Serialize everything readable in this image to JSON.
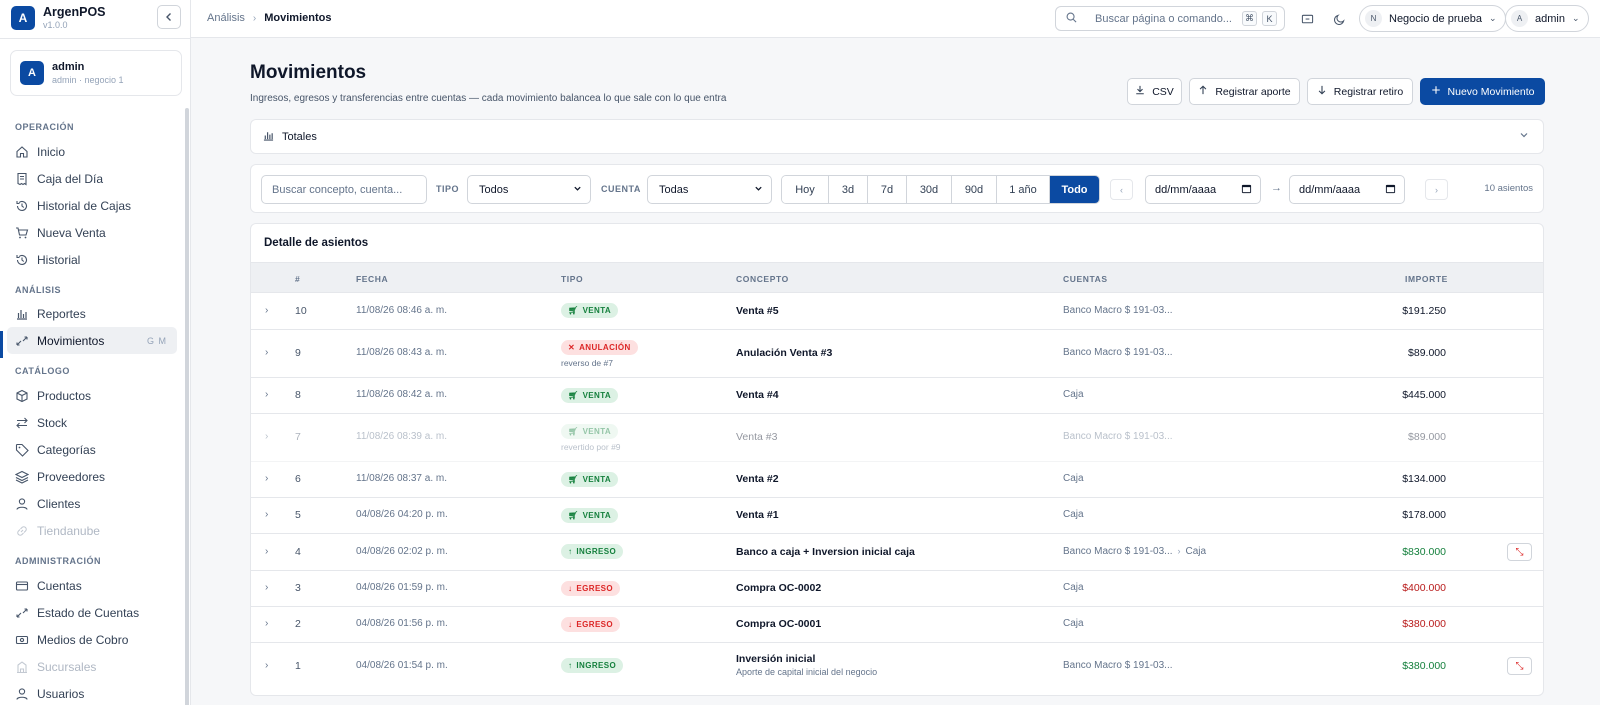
{
  "app": {
    "logo_letter": "A",
    "name": "ArgenPOS",
    "version": "v1.0.0"
  },
  "user": {
    "initial": "A",
    "name": "admin",
    "sub": "admin · negocio 1"
  },
  "nav": {
    "sections": [
      "OPERACIÓN",
      "ANÁLISIS",
      "CATÁLOGO",
      "ADMINISTRACIÓN"
    ],
    "items": [
      {
        "label": "Inicio",
        "icon": "home-icon"
      },
      {
        "label": "Caja del Día",
        "icon": "receipt-icon"
      },
      {
        "label": "Historial de Cajas",
        "icon": "history-icon"
      },
      {
        "label": "Nueva Venta",
        "icon": "cart-icon"
      },
      {
        "label": "Historial",
        "icon": "history-icon"
      },
      {
        "label": "Reportes",
        "icon": "bar-chart-icon"
      },
      {
        "label": "Movimientos",
        "icon": "arrows-icon",
        "shortcut": "G M",
        "active": true
      },
      {
        "label": "Productos",
        "icon": "box-icon"
      },
      {
        "label": "Stock",
        "icon": "swap-icon"
      },
      {
        "label": "Categorías",
        "icon": "tag-icon"
      },
      {
        "label": "Proveedores",
        "icon": "layers-icon"
      },
      {
        "label": "Clientes",
        "icon": "user-icon"
      },
      {
        "label": "Tiendanube",
        "icon": "link-icon",
        "disabled": true
      },
      {
        "label": "Cuentas",
        "icon": "card-icon"
      },
      {
        "label": "Estado de Cuentas",
        "icon": "arrows-icon"
      },
      {
        "label": "Medios de Cobro",
        "icon": "cash-icon"
      },
      {
        "label": "Sucursales",
        "icon": "building-icon",
        "disabled": true
      },
      {
        "label": "Usuarios",
        "icon": "users-icon"
      }
    ]
  },
  "topbar": {
    "breadcrumb": [
      "Análisis",
      "Movimientos"
    ],
    "search_placeholder": "Buscar página o comando...",
    "kbd": [
      "⌘",
      "K"
    ],
    "business": {
      "initial": "N",
      "label": "Negocio de prueba"
    },
    "account": {
      "initial": "A",
      "label": "admin"
    }
  },
  "page": {
    "title": "Movimientos",
    "subtitle": "Ingresos, egresos y transferencias entre cuentas — cada movimiento balancea lo que sale con lo que entra",
    "buttons": {
      "csv": "CSV",
      "aporte": "Registrar aporte",
      "retiro": "Registrar retiro",
      "nuevo": "Nuevo Movimiento"
    },
    "totales": "Totales"
  },
  "filters": {
    "search_placeholder": "Buscar concepto, cuenta...",
    "tipo_label": "TIPO",
    "tipo_value": "Todos",
    "cuenta_label": "CUENTA",
    "cuenta_value": "Todas",
    "ranges": [
      "Hoy",
      "3d",
      "7d",
      "30d",
      "90d",
      "1 año",
      "Todo"
    ],
    "active_range": "Todo",
    "date_from": "dd/mm/aaaa",
    "date_to": "dd/mm/aaaa",
    "count": "10 asientos"
  },
  "table": {
    "title": "Detalle de asientos",
    "headers": [
      "#",
      "FECHA",
      "TIPO",
      "CONCEPTO",
      "CUENTAS",
      "IMPORTE"
    ],
    "rows": [
      {
        "num": "10",
        "date": "11/08/26 08:46 a. m.",
        "tipo": "VENTA",
        "concept": "Venta #5",
        "account": "Banco Macro $ 191-03...",
        "amount": "$191.250"
      },
      {
        "num": "9",
        "date": "11/08/26 08:43 a. m.",
        "tipo": "ANULACIÓN",
        "tipo_sub": "reverso de #7",
        "concept": "Anulación Venta #3",
        "account": "Banco Macro $ 191-03...",
        "amount": "$89.000"
      },
      {
        "num": "8",
        "date": "11/08/26 08:42 a. m.",
        "tipo": "VENTA",
        "concept": "Venta #4",
        "account": "Caja",
        "amount": "$445.000"
      },
      {
        "num": "7",
        "date": "11/08/26 08:39 a. m.",
        "tipo": "VENTA",
        "tipo_sub": "revertido por #9",
        "concept": "Venta #3",
        "account": "Banco Macro $ 191-03...",
        "amount": "$89.000"
      },
      {
        "num": "6",
        "date": "11/08/26 08:37 a. m.",
        "tipo": "VENTA",
        "concept": "Venta #2",
        "account": "Caja",
        "amount": "$134.000"
      },
      {
        "num": "5",
        "date": "04/08/26 04:20 p. m.",
        "tipo": "VENTA",
        "concept": "Venta #1",
        "account": "Caja",
        "amount": "$178.000"
      },
      {
        "num": "4",
        "date": "04/08/26 02:02 p. m.",
        "tipo": "INGRESO",
        "concept": "Banco a caja + Inversion inicial caja",
        "account": "Banco Macro $ 191-03...",
        "account_to": "Caja",
        "amount": "$830.000"
      },
      {
        "num": "3",
        "date": "04/08/26 01:59 p. m.",
        "tipo": "EGRESO",
        "concept": "Compra OC-0002",
        "account": "Caja",
        "amount": "$400.000"
      },
      {
        "num": "2",
        "date": "04/08/26 01:56 p. m.",
        "tipo": "EGRESO",
        "concept": "Compra OC-0001",
        "account": "Caja",
        "amount": "$380.000"
      },
      {
        "num": "1",
        "date": "04/08/26 01:54 p. m.",
        "tipo": "INGRESO",
        "concept": "Inversión inicial",
        "concept_sub": "Aporte de capital inicial del negocio",
        "account": "Banco Macro $ 191-03...",
        "amount": "$380.000"
      }
    ]
  }
}
